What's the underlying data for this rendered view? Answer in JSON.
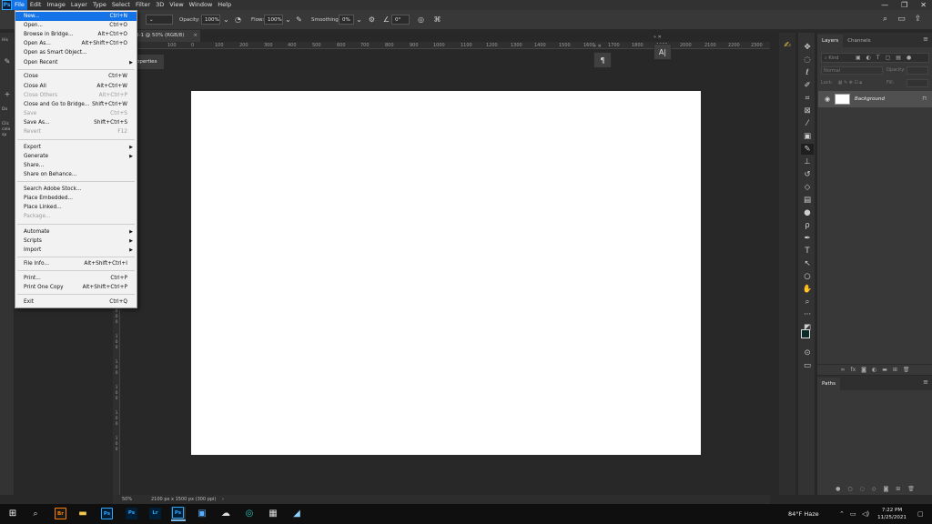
{
  "app": {
    "logo": "Ps"
  },
  "menubar": {
    "items": [
      "File",
      "Edit",
      "Image",
      "Layer",
      "Type",
      "Select",
      "Filter",
      "3D",
      "View",
      "Window",
      "Help"
    ]
  },
  "options": {
    "opacity_label": "Opacity:",
    "opacity_value": "100%",
    "flow_label": "Flow:",
    "flow_value": "100%",
    "smoothing_label": "Smoothing:",
    "smoothing_value": "0%",
    "angle_value": "0°"
  },
  "document": {
    "tab_title": "d-1 @ 50% (RGB/8)",
    "properties_tab": "operties",
    "ruler_h_labels": [
      "100",
      "0",
      "100",
      "200",
      "300",
      "400",
      "500",
      "600",
      "700",
      "800",
      "900",
      "1000",
      "1100",
      "1200",
      "1300",
      "1400",
      "1500",
      "1600",
      "1700",
      "1800",
      "1900",
      "2000",
      "2100",
      "2200",
      "2300"
    ],
    "ruler_v_labels": [
      "0",
      "0",
      "0",
      "1",
      "0",
      "0",
      "1",
      "0",
      "0",
      "1",
      "0",
      "0",
      "1",
      "0",
      "0",
      "1",
      "0",
      "0"
    ]
  },
  "status": {
    "zoom": "50%",
    "doc_info": "2100 px x 1500 px (300 ppi)"
  },
  "left_panel": {
    "labels": [
      "His",
      "Do",
      "Clic",
      "colo",
      "sp"
    ]
  },
  "file_menu": {
    "items": [
      {
        "label": "New...",
        "shortcut": "Ctrl+N"
      },
      {
        "label": "Open...",
        "shortcut": "Ctrl+O"
      },
      {
        "label": "Browse in Bridge...",
        "shortcut": "Alt+Ctrl+O"
      },
      {
        "label": "Open As...",
        "shortcut": "Alt+Shift+Ctrl+O"
      },
      {
        "label": "Open as Smart Object...",
        "shortcut": ""
      },
      {
        "label": "Open Recent",
        "shortcut": ""
      },
      {
        "label": "Close",
        "shortcut": "Ctrl+W"
      },
      {
        "label": "Close All",
        "shortcut": "Alt+Ctrl+W"
      },
      {
        "label": "Close Others",
        "shortcut": "Alt+Ctrl+P"
      },
      {
        "label": "Close and Go to Bridge...",
        "shortcut": "Shift+Ctrl+W"
      },
      {
        "label": "Save",
        "shortcut": "Ctrl+S"
      },
      {
        "label": "Save As...",
        "shortcut": "Shift+Ctrl+S"
      },
      {
        "label": "Revert",
        "shortcut": "F12"
      },
      {
        "label": "Export",
        "shortcut": ""
      },
      {
        "label": "Generate",
        "shortcut": ""
      },
      {
        "label": "Share...",
        "shortcut": ""
      },
      {
        "label": "Share on Behance...",
        "shortcut": ""
      },
      {
        "label": "Search Adobe Stock...",
        "shortcut": ""
      },
      {
        "label": "Place Embedded...",
        "shortcut": ""
      },
      {
        "label": "Place Linked...",
        "shortcut": ""
      },
      {
        "label": "Package...",
        "shortcut": ""
      },
      {
        "label": "Automate",
        "shortcut": ""
      },
      {
        "label": "Scripts",
        "shortcut": ""
      },
      {
        "label": "Import",
        "shortcut": ""
      },
      {
        "label": "File Info...",
        "shortcut": "Alt+Shift+Ctrl+I"
      },
      {
        "label": "Print...",
        "shortcut": "Ctrl+P"
      },
      {
        "label": "Print One Copy",
        "shortcut": "Alt+Shift+Ctrl+P"
      },
      {
        "label": "Exit",
        "shortcut": "Ctrl+Q"
      }
    ]
  },
  "layers_panel": {
    "tabs": [
      "Layers",
      "Channels"
    ],
    "filter_placeholder": "Kind",
    "blend_mode": "Normal",
    "opacity_label": "Opacity:",
    "lock_label": "Lock:",
    "fill_label": "Fill:",
    "layer_name": "Background"
  },
  "paths_panel": {
    "title": "Paths"
  },
  "mini_panels": {
    "paragraph_glyph": "¶",
    "character_glyph": "A|"
  },
  "taskbar": {
    "apps": [
      "Br",
      "Ps",
      "Ps",
      "Lr",
      "Ps"
    ],
    "weather": "84°F  Haze",
    "time": "7:22 PM",
    "date": "11/25/2021"
  },
  "colors": {
    "menu_highlight": "#1473e6",
    "canvas": "#ffffff",
    "workspace": "#282828",
    "ps_blue": "#31a8ff"
  }
}
